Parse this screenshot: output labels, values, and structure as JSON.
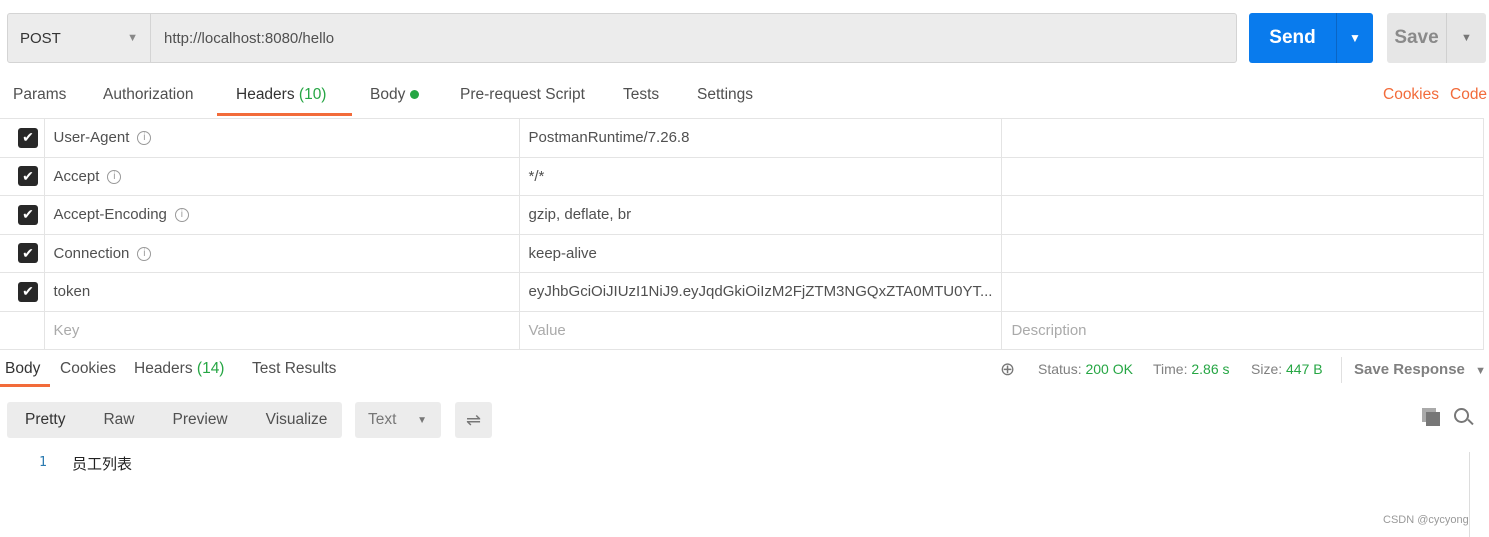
{
  "request": {
    "method": "POST",
    "url": "http://localhost:8080/hello",
    "send_label": "Send",
    "save_label": "Save"
  },
  "tabs": [
    {
      "label": "Params"
    },
    {
      "label": "Authorization"
    },
    {
      "label": "Headers",
      "count": "(10)",
      "active": true
    },
    {
      "label": "Body"
    },
    {
      "label": "Pre-request Script"
    },
    {
      "label": "Tests"
    },
    {
      "label": "Settings"
    }
  ],
  "links": {
    "cookies": "Cookies",
    "code": "Code"
  },
  "headers": [
    {
      "checked": true,
      "key": "User-Agent",
      "value": "PostmanRuntime/7.26.8",
      "info": true
    },
    {
      "checked": true,
      "key": "Accept",
      "value": "*/*",
      "info": true
    },
    {
      "checked": true,
      "key": "Accept-Encoding",
      "value": "gzip, deflate, br",
      "info": true
    },
    {
      "checked": true,
      "key": "Connection",
      "value": "keep-alive",
      "info": true
    },
    {
      "checked": true,
      "key": "token",
      "value": "eyJhbGciOiJIUzI1NiJ9.eyJqdGkiOiIzM2FjZTM3NGQxZTA0MTU0YT...",
      "info": false
    }
  ],
  "placeholders": {
    "key": "Key",
    "value": "Value",
    "description": "Description"
  },
  "response": {
    "tabs": [
      {
        "label": "Body",
        "active": true
      },
      {
        "label": "Cookies"
      },
      {
        "label": "Headers",
        "count": "(14)"
      },
      {
        "label": "Test Results"
      }
    ],
    "status_label": "Status:",
    "status": "200 OK",
    "time_label": "Time:",
    "time": "2.86 s",
    "size_label": "Size:",
    "size": "447 B",
    "save_response": "Save Response",
    "view_modes": [
      "Pretty",
      "Raw",
      "Preview",
      "Visualize"
    ],
    "format": "Text",
    "lines": [
      {
        "num": "1",
        "text": "员工列表"
      }
    ]
  },
  "watermark": "CSDN @cycyong",
  "colors": {
    "send": "#097bed",
    "accent": "#f26b3a",
    "success": "#26a644"
  }
}
